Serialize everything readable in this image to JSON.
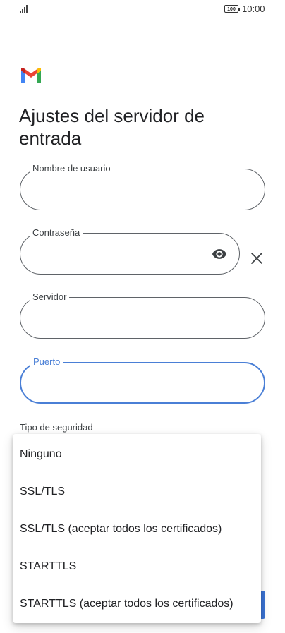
{
  "status_bar": {
    "battery": "100",
    "time": "10:00"
  },
  "page": {
    "title": "Ajustes del servidor de entrada"
  },
  "fields": {
    "username": {
      "label": "Nombre de usuario",
      "value": ""
    },
    "password": {
      "label": "Contraseña",
      "value": ""
    },
    "server": {
      "label": "Servidor",
      "value": ""
    },
    "port": {
      "label": "Puerto",
      "value": ""
    }
  },
  "security": {
    "label": "Tipo de seguridad",
    "options": [
      "Ninguno",
      "SSL/TLS",
      "SSL/TLS (aceptar todos los certificados)",
      "STARTTLS",
      "STARTTLS (aceptar todos los certificados)"
    ]
  },
  "icons": {
    "logo": "gmail-logo",
    "password_toggle": "eye-icon",
    "clear": "close-icon"
  },
  "colors": {
    "accent": "#4a7fd6",
    "gmail_red": "#ea4335",
    "gmail_blue": "#4285f4",
    "gmail_green": "#34a853",
    "gmail_yellow": "#fbbc04"
  }
}
